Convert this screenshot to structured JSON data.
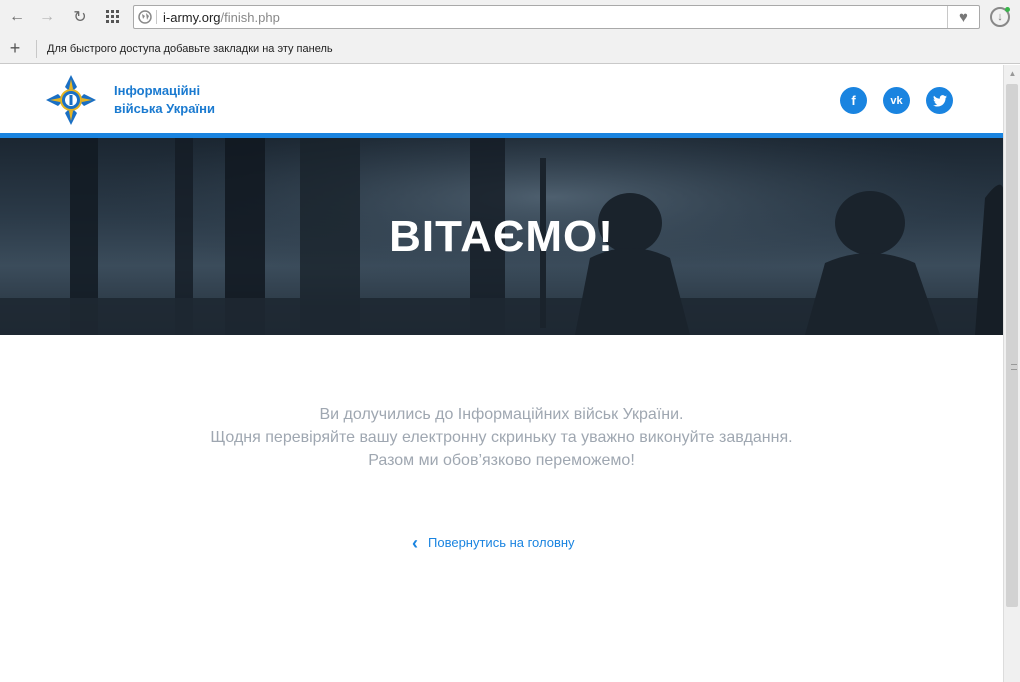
{
  "browser": {
    "url_host": "i-army.org",
    "url_path": "/finish.php",
    "bookmarks_hint": "Для быстрого доступа добавьте закладки на эту панель",
    "icons": {
      "back": "arrow-left-icon",
      "forward": "arrow-right-icon",
      "reload": "reload-icon",
      "speed_dial": "grid-icon",
      "site_info": "globe-icon",
      "bookmark": "heart-icon",
      "download": "download-icon",
      "add_bookmark": "plus-icon"
    }
  },
  "header": {
    "site_name_line1": "Інформаційні",
    "site_name_line2": "війська України",
    "social": [
      {
        "name": "facebook",
        "glyph": "f"
      },
      {
        "name": "vk",
        "glyph": "vk"
      },
      {
        "name": "twitter",
        "glyph": "t"
      }
    ]
  },
  "hero": {
    "title": "ВІТАЄМО!"
  },
  "content": {
    "line1": "Ви долучились до Інформаційних військ України.",
    "line2": "Щодня перевіряйте вашу електронну скриньку та уважно виконуйте завдання.",
    "line3": "Разом ми обов’язково переможемо!",
    "back_link": "Повернутись на головну"
  },
  "colors": {
    "accent": "#1a84e0",
    "site_name": "#1a7ad0",
    "message_text": "#9fa7b1"
  }
}
